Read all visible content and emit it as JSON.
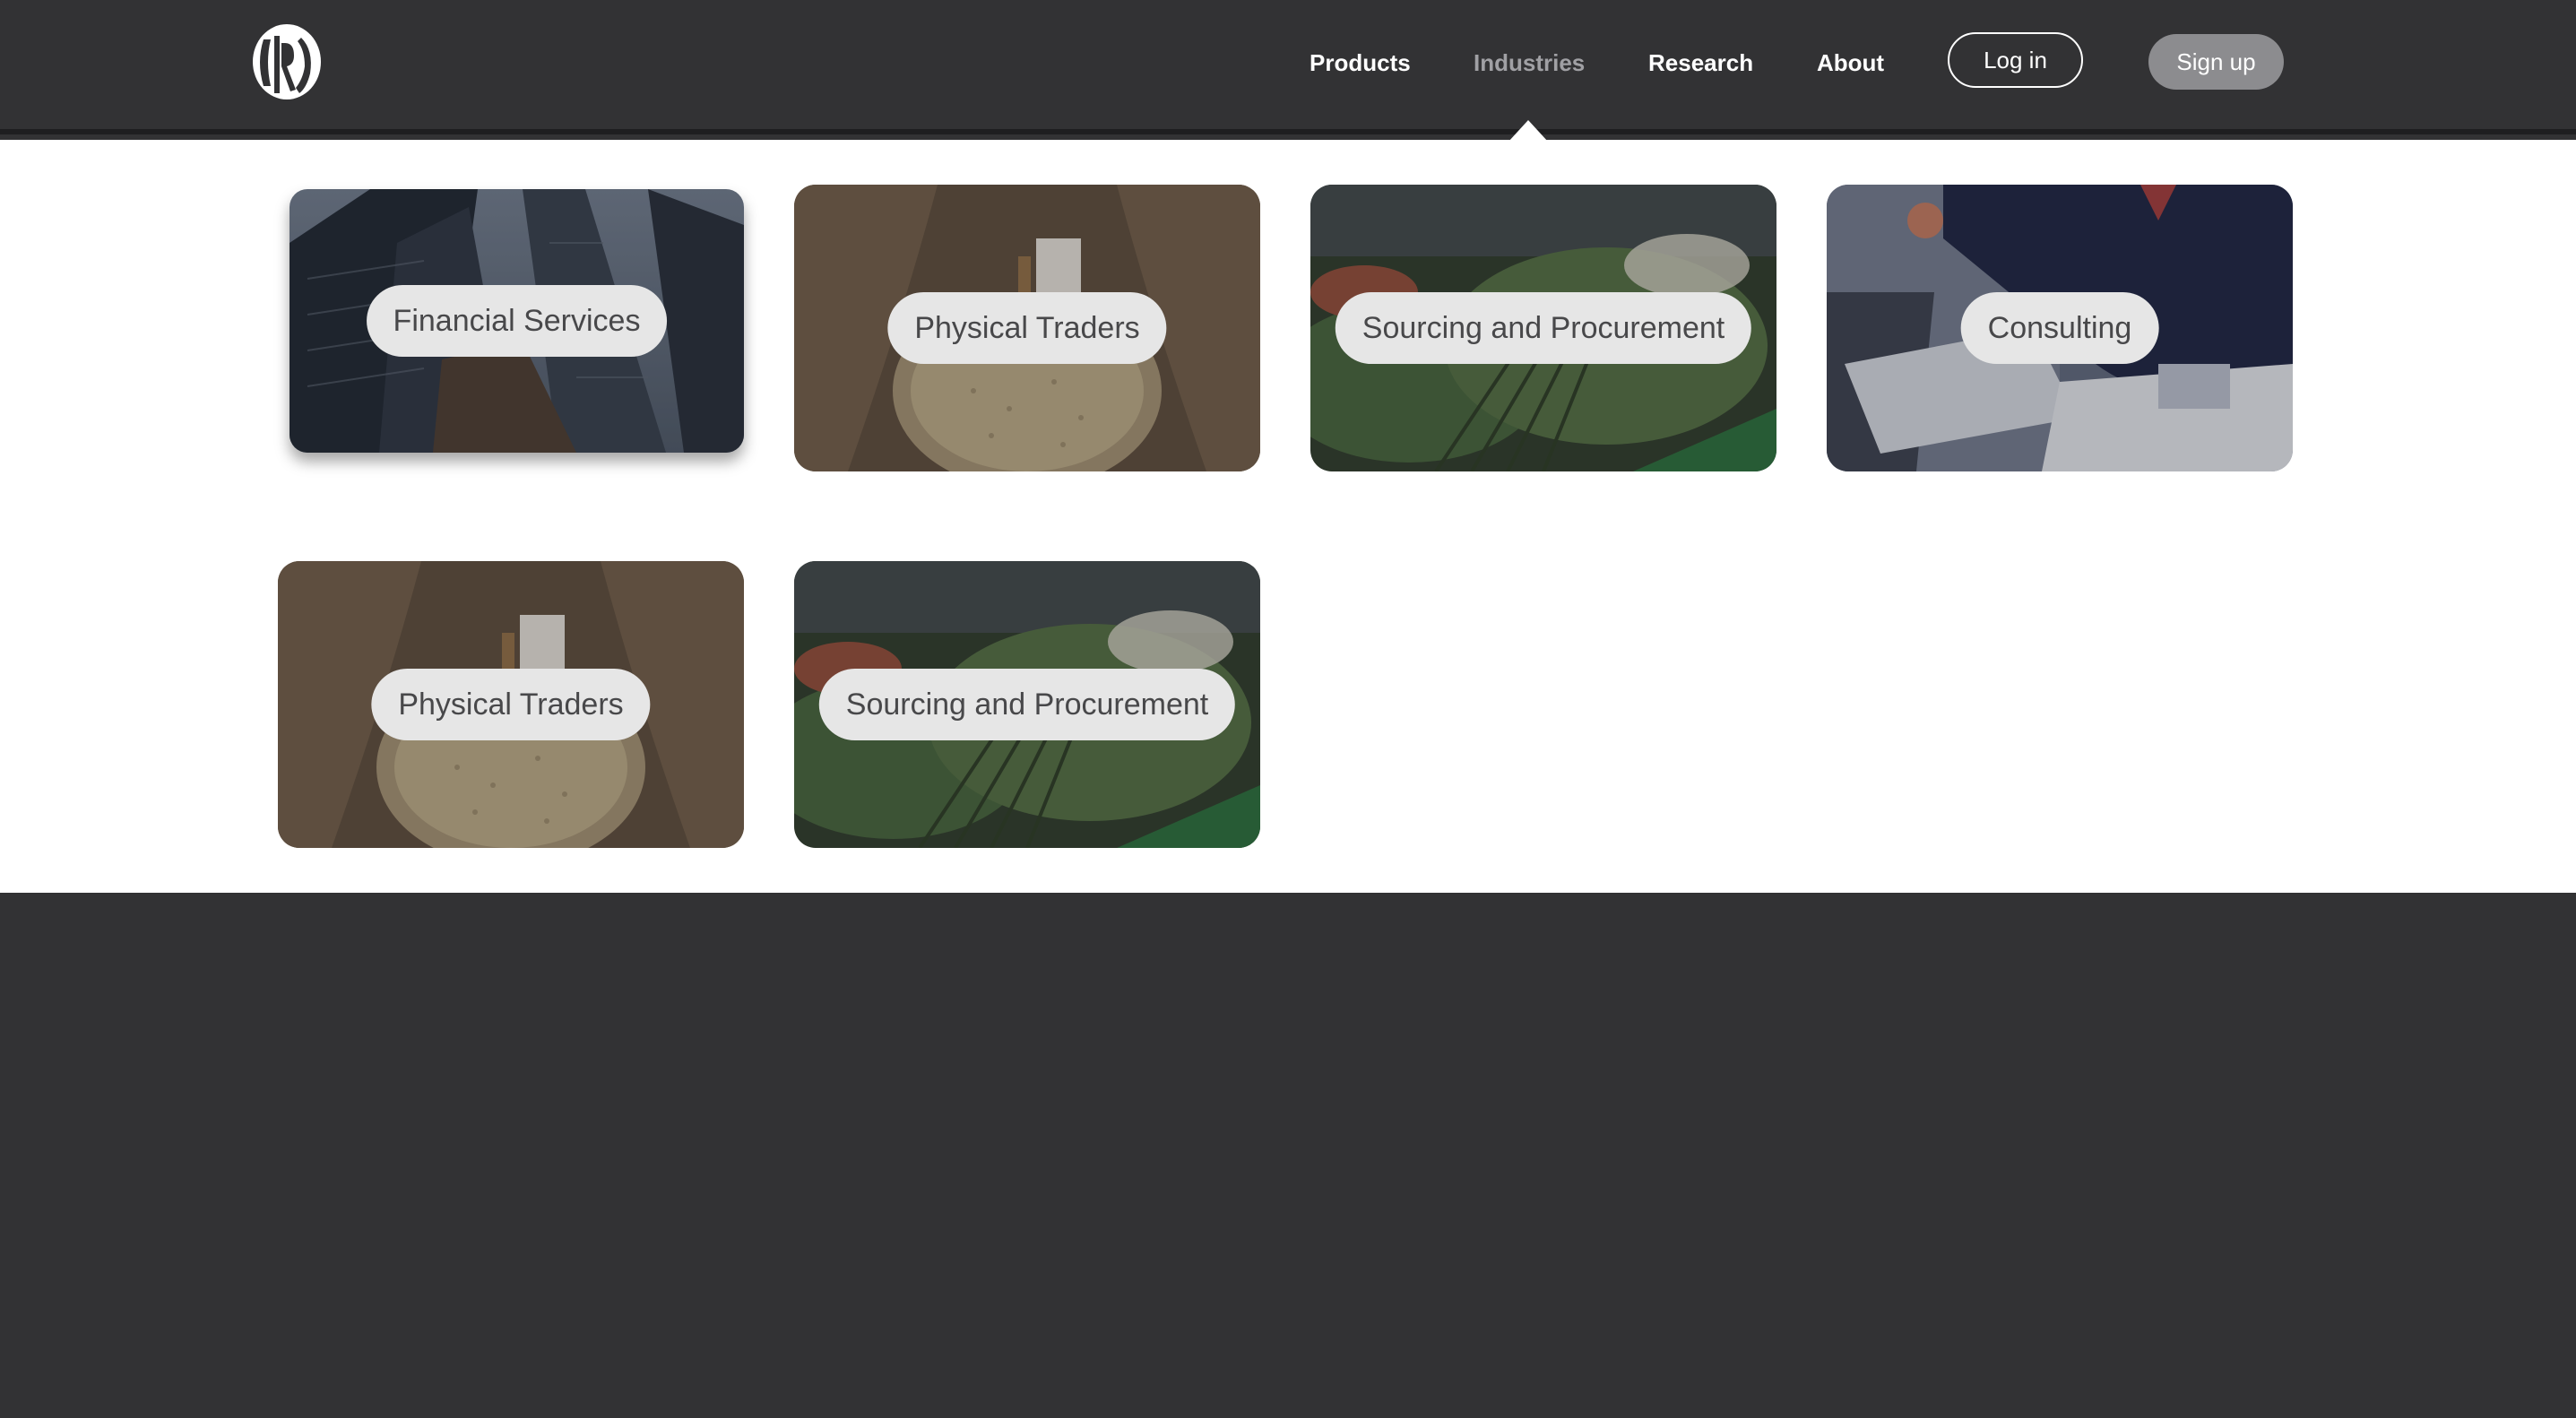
{
  "header": {
    "logo_text": "GRO",
    "nav": [
      {
        "label": "Products",
        "active": false
      },
      {
        "label": "Industries",
        "active": true
      },
      {
        "label": "Research",
        "active": false
      },
      {
        "label": "About",
        "active": false
      }
    ],
    "login_label": "Log in",
    "signup_label": "Sign up"
  },
  "dropdown": {
    "cards": [
      {
        "label": "Financial Services",
        "image": "skyscrapers-image"
      },
      {
        "label": "Physical Traders",
        "image": "grain-sacks-image"
      },
      {
        "label": "Sourcing and Procurement",
        "image": "vegetable-market-image"
      },
      {
        "label": "Consulting",
        "image": "business-meeting-image"
      },
      {
        "label": "Physical Traders",
        "image": "grain-sacks-image"
      },
      {
        "label": "Sourcing and Procurement",
        "image": "vegetable-market-image"
      }
    ]
  },
  "colors": {
    "header_bg": "#323234",
    "panel_bg": "#ffffff",
    "pill_bg": "#e6e6e6",
    "pill_text": "#48484a",
    "nav_active": "#a0a0a4",
    "signup_bg": "#8c8c8f"
  }
}
